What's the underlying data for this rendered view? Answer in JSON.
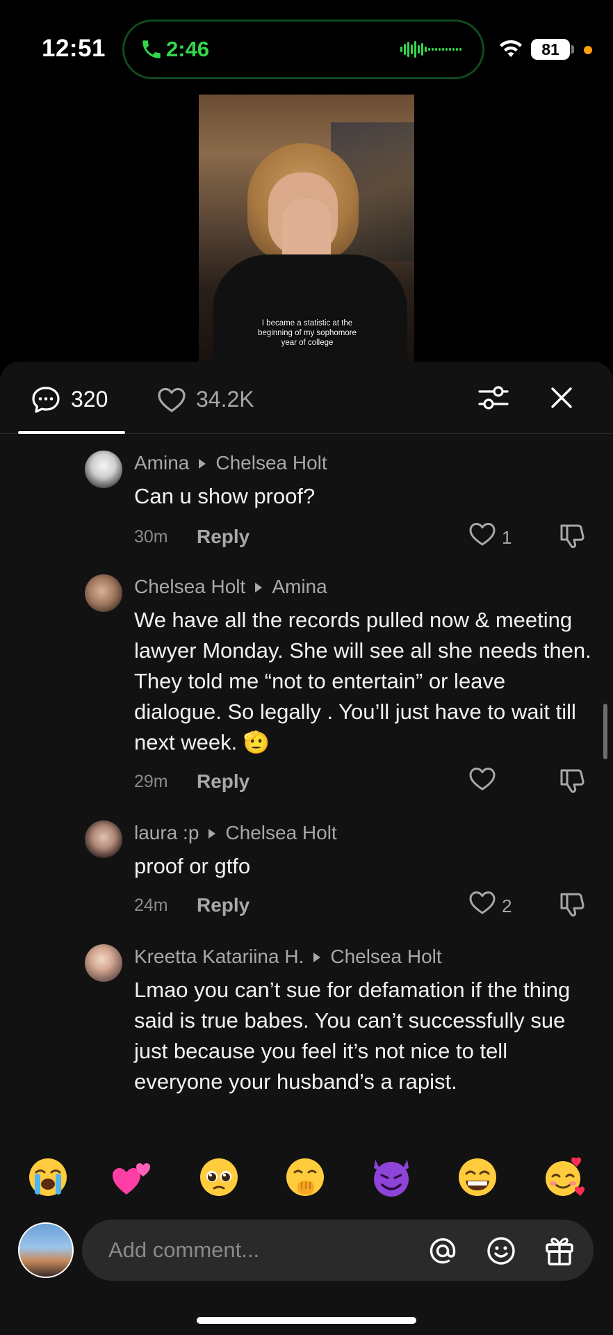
{
  "status_bar": {
    "time": "12:51",
    "call_duration": "2:46",
    "battery": "81",
    "accent_green": "#32d74b",
    "privacy_dot": "#ff9f0a"
  },
  "video": {
    "caption": "I became a statistic at the beginning of my sophomore year of college"
  },
  "tabs": {
    "comments_count": "320",
    "likes_count": "34.2K"
  },
  "comments": [
    {
      "author": "Amina",
      "reply_to": "Chelsea Holt",
      "text": "Can u show proof?",
      "time": "30m",
      "reply_label": "Reply",
      "likes": "1"
    },
    {
      "author": "Chelsea Holt",
      "reply_to": "Amina",
      "text": "We have all the records pulled now & meeting lawyer Monday. She will see all she needs then. They told me “not to entertain” or leave dialogue. So legally . You’ll just have to wait till next week. 🫡",
      "time": "29m",
      "reply_label": "Reply",
      "likes": ""
    },
    {
      "author": "laura :p",
      "reply_to": "Chelsea Holt",
      "text": "proof or gtfo",
      "time": "24m",
      "reply_label": "Reply",
      "likes": "2"
    },
    {
      "author": "Kreetta Katariina H.",
      "reply_to": "Chelsea Holt",
      "text": "Lmao you can’t sue for defamation if the thing said is true babes. You can’t successfully sue just because you feel it’s not nice to tell everyone your husband’s a rapist.",
      "time": "",
      "reply_label": "",
      "likes": ""
    }
  ],
  "quick_emojis": [
    "loudly-crying-face",
    "two-hearts",
    "pleading-face",
    "face-with-hand-over-mouth",
    "smiling-face-with-horns",
    "beaming-face",
    "smiling-face-with-hearts"
  ],
  "composer": {
    "placeholder": "Add comment..."
  }
}
